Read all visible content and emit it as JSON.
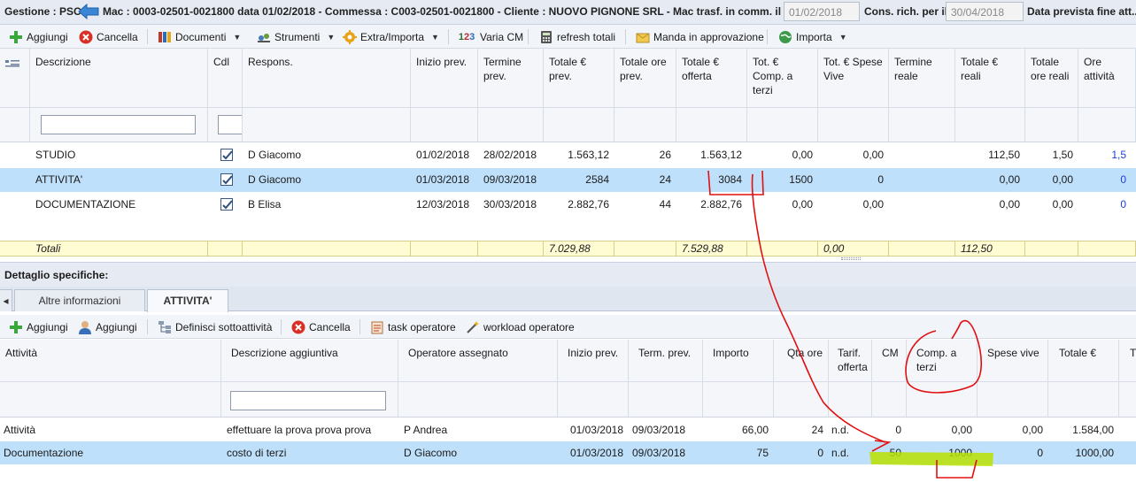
{
  "header": {
    "gestione": "Gestione : PSC",
    "mac": "Mac : 0003-02501-0021800 data 01/02/2018 - Commessa : C003-02501-0021800 - Cliente : NUOVO PIGNONE SRL -",
    "mac_trasf_label": "Mac trasf. in comm. il :",
    "mac_trasf_value": "01/02/2018",
    "cons_rich_label": "Cons. rich. per il :",
    "cons_rich_value": "30/04/2018",
    "data_prevista_label": "Data prevista fine att..."
  },
  "toolbar1": {
    "aggiungi": "Aggiungi",
    "cancella": "Cancella",
    "documenti": "Documenti",
    "strumenti": "Strumenti",
    "extra_importa": "Extra/Importa",
    "varia_cm": "Varia CM",
    "refresh_totali": "refresh totali",
    "manda_approvazione": "Manda in approvazione",
    "importa": "Importa"
  },
  "grid1": {
    "headers": {
      "descrizione": "Descrizione",
      "cdl": "Cdl",
      "respons": "Respons.",
      "inizio_prev": "Inizio prev.",
      "termine_prev": "Termine prev.",
      "totale_prev": "Totale € prev.",
      "totale_ore_prev": "Totale ore prev.",
      "totale_offerta": "Totale € offerta",
      "tot_comp_terzi": "Tot. € Comp. a terzi",
      "tot_spese_vive": "Tot. € Spese Vive",
      "termine_reale": "Termine reale",
      "totale_reali": "Totale € reali",
      "totale_ore_reali": "Totale ore reali",
      "ore_attivita": "Ore attività"
    },
    "rows": [
      {
        "descrizione": "STUDIO",
        "respons": "D Giacomo",
        "inizio": "01/02/2018",
        "termine": "28/02/2018",
        "totale_prev": "1.563,12",
        "ore_prev": "26",
        "offerta": "1.563,12",
        "comp_terzi": "0,00",
        "spese_vive": "0,00",
        "termine_reale": "",
        "totale_reali": "112,50",
        "ore_reali": "1,50",
        "ore_attivita": "1,5"
      },
      {
        "descrizione": "ATTIVITA'",
        "respons": "D Giacomo",
        "inizio": "01/03/2018",
        "termine": "09/03/2018",
        "totale_prev": "2584",
        "ore_prev": "24",
        "offerta": "3084",
        "comp_terzi": "1500",
        "spese_vive": "0",
        "termine_reale": "",
        "totale_reali": "0,00",
        "ore_reali": "0,00",
        "ore_attivita": "0"
      },
      {
        "descrizione": "DOCUMENTAZIONE",
        "respons": "B Elisa",
        "inizio": "12/03/2018",
        "termine": "30/03/2018",
        "totale_prev": "2.882,76",
        "ore_prev": "44",
        "offerta": "2.882,76",
        "comp_terzi": "0,00",
        "spese_vive": "0,00",
        "termine_reale": "",
        "totale_reali": "0,00",
        "ore_reali": "0,00",
        "ore_attivita": "0"
      }
    ],
    "totals": {
      "label": "Totali",
      "totale_prev": "7.029,88",
      "offerta": "7.529,88",
      "spese_vive": "0,00",
      "totale_reali": "112,50"
    }
  },
  "detail": {
    "section_title": "Dettaglio specifiche:",
    "tabs": [
      "Altre informazioni",
      "ATTIVITA'"
    ]
  },
  "toolbar2": {
    "aggiungi_1": "Aggiungi",
    "aggiungi_2": "Aggiungi",
    "definisci": "Definisci sottoattività",
    "cancella": "Cancella",
    "task_operatore": "task operatore",
    "workload_operatore": "workload operatore"
  },
  "grid2": {
    "headers": {
      "attivita": "Attività",
      "descrizione_aggiuntiva": "Descrizione aggiuntiva",
      "operatore": "Operatore assegnato",
      "inizio_prev": "Inizio prev.",
      "term_prev": "Term. prev.",
      "importo": "Importo",
      "qta_ore": "Qta ore",
      "tarif_offerta": "Tarif. offerta",
      "cm": "CM",
      "comp_terzi": "Comp. a terzi",
      "spese_vive": "Spese vive",
      "totale": "Totale €",
      "t": "T"
    },
    "rows": [
      {
        "attivita": "Attività",
        "descrizione": "effettuare la prova prova prova",
        "operatore": "P Andrea",
        "inizio": "01/03/2018",
        "term": "09/03/2018",
        "importo": "66,00",
        "qta_ore": "24",
        "tarif": "n.d.",
        "cm": "0",
        "comp_terzi": "0,00",
        "spese_vive": "0,00",
        "totale": "1.584,00"
      },
      {
        "attivita": "Documentazione",
        "descrizione": "costo di terzi",
        "operatore": "D Giacomo",
        "inizio": "01/03/2018",
        "term": "09/03/2018",
        "importo": "75",
        "qta_ore": "0",
        "tarif": "n.d.",
        "cm": "50",
        "comp_terzi": "1000",
        "spese_vive": "0",
        "totale": "1000,00"
      }
    ]
  },
  "colors": {
    "selected_row": "#bfe0fa",
    "totals_row": "#fffbd2",
    "annotation_red": "#e01010",
    "highlight_green": "#b8e000"
  }
}
